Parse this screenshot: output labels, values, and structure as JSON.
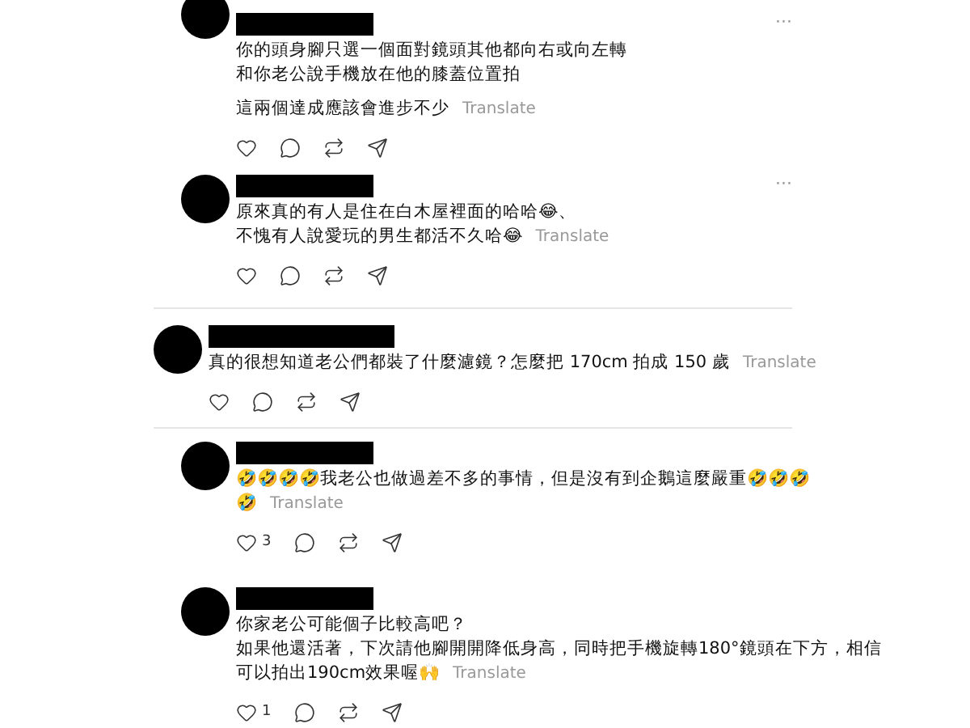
{
  "comments": [
    {
      "kind": "plain",
      "paragraphs": [
        [
          "你的頭身腳只選一個面對鏡頭其他都向右或向左轉",
          "和你老公說手機放在他的膝蓋位置拍"
        ],
        [
          "這兩個達成應該會進步不少"
        ]
      ],
      "translate": "Translate",
      "more": "···"
    },
    {
      "kind": "plain",
      "paragraphs": [
        [
          "原來真的有人是住在白木屋裡面的哈哈😂、",
          "不愧有人說愛玩的男生都活不久哈😂"
        ]
      ],
      "translate": "Translate",
      "more": "···"
    },
    {
      "kind": "boxed",
      "paragraphs": [
        [
          "真的很想知道老公們都裝了什麼濾鏡？怎麼把 170cm 拍成 150 歲"
        ]
      ],
      "translate": "Translate"
    },
    {
      "kind": "plain",
      "paragraphs": [
        [
          "🤣🤣🤣🤣我老公也做過差不多的事情，但是沒有到企鵝這麼嚴重🤣🤣🤣",
          "🤣"
        ]
      ],
      "translate": "Translate",
      "likes": "3"
    },
    {
      "kind": "plain",
      "paragraphs": [
        [
          "你家老公可能個子比較高吧？",
          "如果他還活著，下次請他腳開開降低身高，同時把手機旋轉180°鏡頭在下方，相信",
          "可以拍出190cm效果喔🙌"
        ]
      ],
      "translate": "Translate",
      "likes": "1"
    }
  ]
}
